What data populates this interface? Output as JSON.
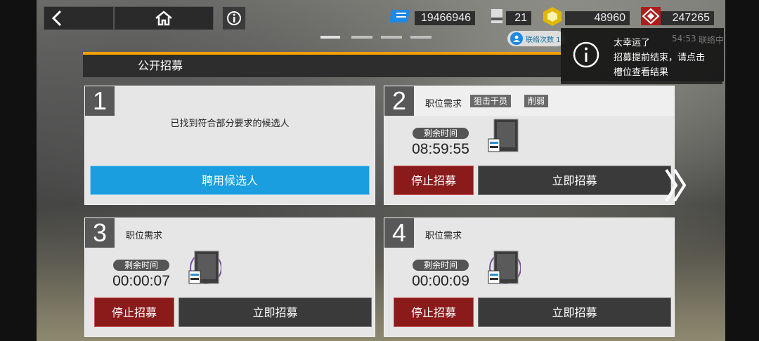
{
  "header": {
    "title": "公开招募"
  },
  "resources": [
    {
      "name": "originium-prime",
      "value": "19466946",
      "color": "#1e88e5"
    },
    {
      "name": "recruit-permits",
      "value": "21",
      "color": "#cccccc"
    },
    {
      "name": "lmd",
      "value": "48960",
      "color": "#e0b800"
    },
    {
      "name": "orundum",
      "value": "247265",
      "color": "#c02020"
    }
  ],
  "contact": {
    "label": "联络次数 1"
  },
  "notification": {
    "title": "太幸运了",
    "line1": "招募提前结束，请点击",
    "line2": "槽位查看结果",
    "ghost_time": "54:53",
    "ghost_label": "联络中"
  },
  "slots": [
    {
      "number": "1",
      "found_text": "已找到符合部分要求的候选人",
      "hire_label": "聘用候选人"
    },
    {
      "number": "2",
      "req_label": "职位需求",
      "tags": [
        "狙击干员",
        "削弱"
      ],
      "remain_label": "剩余时间",
      "time": "08:59:55",
      "stop_label": "停止招募",
      "now_label": "立即招募"
    },
    {
      "number": "3",
      "req_label": "职位需求",
      "remain_label": "剩余时间",
      "time": "00:00:07",
      "stop_label": "停止招募",
      "now_label": "立即招募"
    },
    {
      "number": "4",
      "req_label": "职位需求",
      "remain_label": "剩余时间",
      "time": "00:00:09",
      "stop_label": "停止招募",
      "now_label": "立即招募"
    }
  ]
}
